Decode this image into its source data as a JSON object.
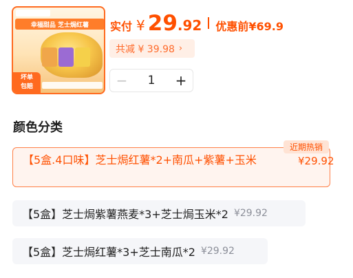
{
  "product": {
    "image_banner": "幸福甜品 芝士焗红薯",
    "image_badge_line1": "坏单",
    "image_badge_line2": "包赔"
  },
  "price": {
    "label": "实付",
    "currency": "¥",
    "integer": "29",
    "decimal": ".92",
    "original_label": "优惠前",
    "original_value": "¥69.9"
  },
  "discount": {
    "label": "共减 ¥ 39.98",
    "chevron": "›"
  },
  "quantity": {
    "minus": "−",
    "value": "1",
    "plus": "+"
  },
  "section": {
    "title": "颜色分类"
  },
  "options": [
    {
      "name": "【5盒.4口味】芝士焗红薯*2+南瓜+紫薯+玉米",
      "price": "¥29.92",
      "badge": "近期热销",
      "selected": true
    },
    {
      "name": "【5盒】芝士焗紫薯燕麦*3+芝士焗玉米*2",
      "price": "¥29.92",
      "selected": false
    },
    {
      "name": "【5盒】芝士焗红薯*3+芝士南瓜*2",
      "price": "¥29.92",
      "selected": false
    }
  ],
  "colors": {
    "accent": "#ff5000",
    "selected_bg": "#fff4ef",
    "option_bg": "#f5f6f9"
  }
}
